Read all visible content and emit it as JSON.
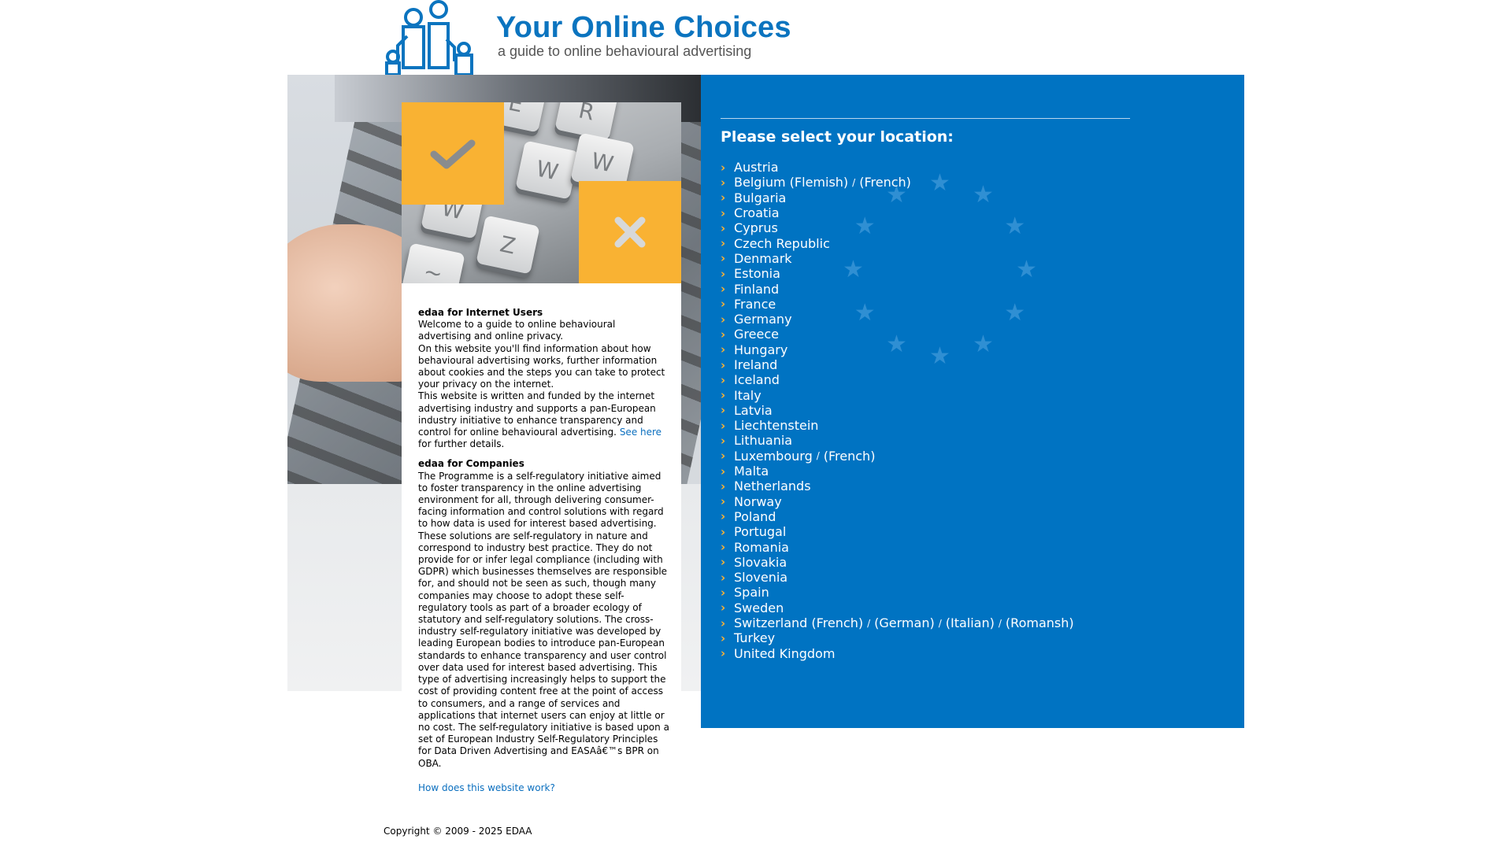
{
  "header": {
    "title": "Your Online Choices",
    "tagline": "a guide to online behavioural advertising"
  },
  "content": {
    "users_heading": "edaa for Internet Users",
    "users_p1": "Welcome to a guide to online behavioural advertising and online privacy.",
    "users_p2": "On this website you'll find information about how behavioural advertising works, further information about cookies and the steps you can take to protect your privacy on the internet.",
    "users_p3": "This website is written and funded by the internet advertising industry and supports a pan-European industry initiative to enhance transparency and control for online behavioural advertising.",
    "see_here_link": "See here",
    "further_details": "for further details.",
    "companies_heading": "edaa for Companies",
    "companies_text": "The Programme is a self-regulatory initiative aimed to foster transparency in the online advertising environment for all, through delivering consumer-facing information and control solutions with regard to how data is used for interest based advertising. These solutions are self-regulatory in nature and correspond to industry best practice. They do not provide for or infer legal compliance (including with GDPR) which businesses themselves are responsible for, and should not be seen as such, though many companies may choose to adopt these self-regulatory tools as part of a broader ecology of statutory and self-regulatory solutions. The cross-industry self-regulatory initiative was developed by leading European bodies to introduce pan-European standards to enhance transparency and user control over data used for interest based advertising. This type of advertising increasingly helps to support the cost of providing content free at the point of access to consumers, and a range of services and applications that internet users can enjoy at little or no cost. The self-regulatory initiative is based upon a set of European Industry Self-Regulatory Principles for Data Driven Advertising and EASAâ€™s BPR on OBA.",
    "how_link": "How does this website work?"
  },
  "keyboard_keys": [
    "E",
    "R",
    "W",
    "W",
    "W",
    "Z",
    "~"
  ],
  "location": {
    "heading": "Please select your location:",
    "countries": [
      [
        "Austria"
      ],
      [
        "Belgium (Flemish)",
        "(French)"
      ],
      [
        "Bulgaria"
      ],
      [
        "Croatia"
      ],
      [
        "Cyprus"
      ],
      [
        "Czech Republic"
      ],
      [
        "Denmark"
      ],
      [
        "Estonia"
      ],
      [
        "Finland"
      ],
      [
        "France"
      ],
      [
        "Germany"
      ],
      [
        "Greece"
      ],
      [
        "Hungary"
      ],
      [
        "Ireland"
      ],
      [
        "Iceland"
      ],
      [
        "Italy"
      ],
      [
        "Latvia"
      ],
      [
        "Liechtenstein"
      ],
      [
        "Lithuania"
      ],
      [
        "Luxembourg",
        "(French)"
      ],
      [
        "Malta"
      ],
      [
        "Netherlands"
      ],
      [
        "Norway"
      ],
      [
        "Poland"
      ],
      [
        "Portugal"
      ],
      [
        "Romania"
      ],
      [
        "Slovakia"
      ],
      [
        "Slovenia"
      ],
      [
        "Spain"
      ],
      [
        "Sweden"
      ],
      [
        "Switzerland (French)",
        "(German)",
        "(Italian)",
        "(Romansh)"
      ],
      [
        "Turkey"
      ],
      [
        "United Kingdom"
      ]
    ],
    "separator": "/"
  },
  "footer": {
    "copyright": "Copyright © 2009 - 2025 EDAA"
  },
  "colors": {
    "brand_blue": "#0073c2",
    "title_blue": "#0b74bf",
    "accent_orange": "#f9b233"
  }
}
